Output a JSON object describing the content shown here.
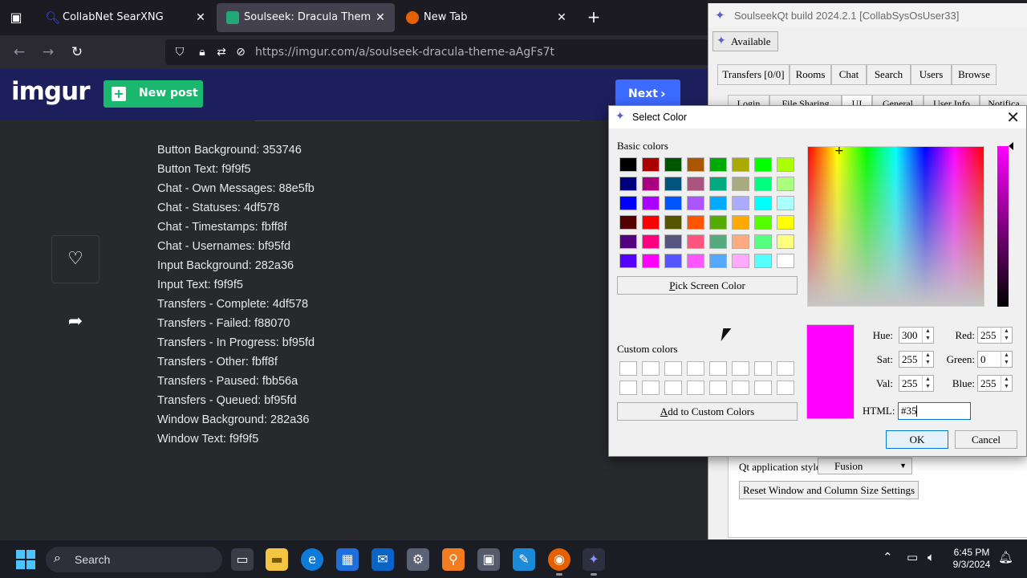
{
  "browser": {
    "tabs": [
      {
        "title": "CollabNet SearXNG",
        "favicon_color": "#3050ff"
      },
      {
        "title": "Soulseek: Dracula Theme - Imgur",
        "favicon_color": "#23a877"
      },
      {
        "title": "New Tab",
        "favicon_color": "#e66000"
      }
    ],
    "url": "https://imgur.com/a/soulseek-dracula-theme-aAgFs7t"
  },
  "imgur": {
    "logo": "imgur",
    "new_post_label": "New post",
    "next_label": "Next",
    "colors": {
      "header": "#1c1f5b",
      "new_post": "#1bb76e",
      "next": "#3d6bff"
    },
    "description_lines": [
      "Button Background: 353746",
      "Button Text: f9f9f5",
      "Chat - Own Messages: 88e5fb",
      "Chat - Statuses: 4df578",
      "Chat - Timestamps: fbff8f",
      "Chat - Usernames: bf95fd",
      "Input Background: 282a36",
      "Input Text: f9f9f5",
      "Transfers - Complete: 4df578",
      "Transfers - Failed: f88070",
      "Transfers - In Progress: bf95fd",
      "Transfers - Other: fbff8f",
      "Transfers - Paused: fbb56a",
      "Transfers - Queued: bf95fd",
      "Window Background: 282a36",
      "Window Text: f9f9f5"
    ]
  },
  "soulseek": {
    "title": "SoulseekQt build 2024.2.1 [CollabSysOsUser33]",
    "status_button": "Available",
    "main_tabs": [
      "Transfers [0/0]",
      "Rooms",
      "Chat",
      "Search",
      "Users",
      "Browse"
    ],
    "sub_tabs": [
      "Login",
      "File Sharing",
      "UI",
      "General",
      "User Info",
      "Notifica"
    ],
    "qt_style_label": "Qt application style:",
    "qt_style_value": "Fusion",
    "reset_button": "Reset Window and Column Size Settings"
  },
  "dialog": {
    "title": "Select Color",
    "basic_colors_label": "Basic colors",
    "basic_colors": [
      [
        "#000000",
        "#aa0000",
        "#005500",
        "#aa5500",
        "#00aa00",
        "#aaaa00",
        "#00ff00",
        "#aaff00"
      ],
      [
        "#00007f",
        "#aa007f",
        "#00557f",
        "#aa557f",
        "#00aa7f",
        "#aaaa7f",
        "#00ff7f",
        "#aaff7f"
      ],
      [
        "#0000ff",
        "#aa00ff",
        "#0055ff",
        "#aa55ff",
        "#00aaff",
        "#aaaaff",
        "#00ffff",
        "#aaffff"
      ],
      [
        "#550000",
        "#ff0000",
        "#555500",
        "#ff5500",
        "#55aa00",
        "#ffaa00",
        "#55ff00",
        "#ffff00"
      ],
      [
        "#55007f",
        "#ff007f",
        "#55557f",
        "#ff557f",
        "#55aa7f",
        "#ffaa7f",
        "#55ff7f",
        "#ffff7f"
      ],
      [
        "#5500ff",
        "#ff00ff",
        "#5555ff",
        "#ff55ff",
        "#55aaff",
        "#ffaaff",
        "#55ffff",
        "#ffffff"
      ]
    ],
    "pick_screen_label": "Pick Screen Color",
    "custom_colors_label": "Custom colors",
    "add_custom_label": "Add to Custom Colors",
    "current_color": "#ff00ff",
    "fields": {
      "hue_label": "Hue:",
      "hue": "300",
      "sat_label": "Sat:",
      "sat": "255",
      "val_label": "Val:",
      "val": "255",
      "red_label": "Red:",
      "red": "255",
      "green_label": "Green:",
      "green": "0",
      "blue_label": "Blue:",
      "blue": "255"
    },
    "html_label": "HTML:",
    "html_value": "#35",
    "ok_label": "OK",
    "cancel_label": "Cancel"
  },
  "taskbar": {
    "search_label": "Search",
    "time": "6:45 PM",
    "date": "9/3/2024"
  }
}
